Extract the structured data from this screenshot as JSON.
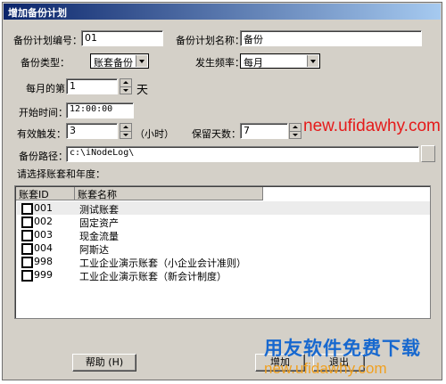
{
  "window": {
    "title": "增加备份计划"
  },
  "form": {
    "plan_no_label": "备份计划编号：",
    "plan_no_value": "01",
    "plan_name_label": "备份计划名称：",
    "plan_name_value": "备份",
    "type_label": "备份类型：",
    "type_value": "账套备份",
    "freq_label": "发生频率：",
    "freq_value": "每月",
    "day_label": "每月的第",
    "day_value": "1",
    "day_unit": "天",
    "start_label": "开始时间：",
    "start_value": "12:00:00",
    "trigger_label": "有效触发：",
    "trigger_value": "3",
    "trigger_unit": "（小时）",
    "keep_label": "保留天数：",
    "keep_value": "7",
    "path_label": "备份路径：",
    "path_value": "c:\\iNodeLog\\",
    "select_prompt": "请选择账套和年度："
  },
  "list": {
    "col_id": "账套ID",
    "col_name": "账套名称",
    "rows": [
      {
        "code": "001",
        "name": "测试账套"
      },
      {
        "code": "002",
        "name": "固定资产"
      },
      {
        "code": "003",
        "name": "现金流量"
      },
      {
        "code": "004",
        "name": "阿斯达"
      },
      {
        "code": "998",
        "name": "工业企业演示账套（小企业会计准则）"
      },
      {
        "code": "999",
        "name": "工业企业演示账套（新会计制度）"
      }
    ]
  },
  "buttons": {
    "help": "帮助 (H)",
    "add": "增加",
    "exit": "退出"
  },
  "watermark": {
    "url": "new.ufidawhy.com",
    "brand": "用友软件免费下载"
  }
}
